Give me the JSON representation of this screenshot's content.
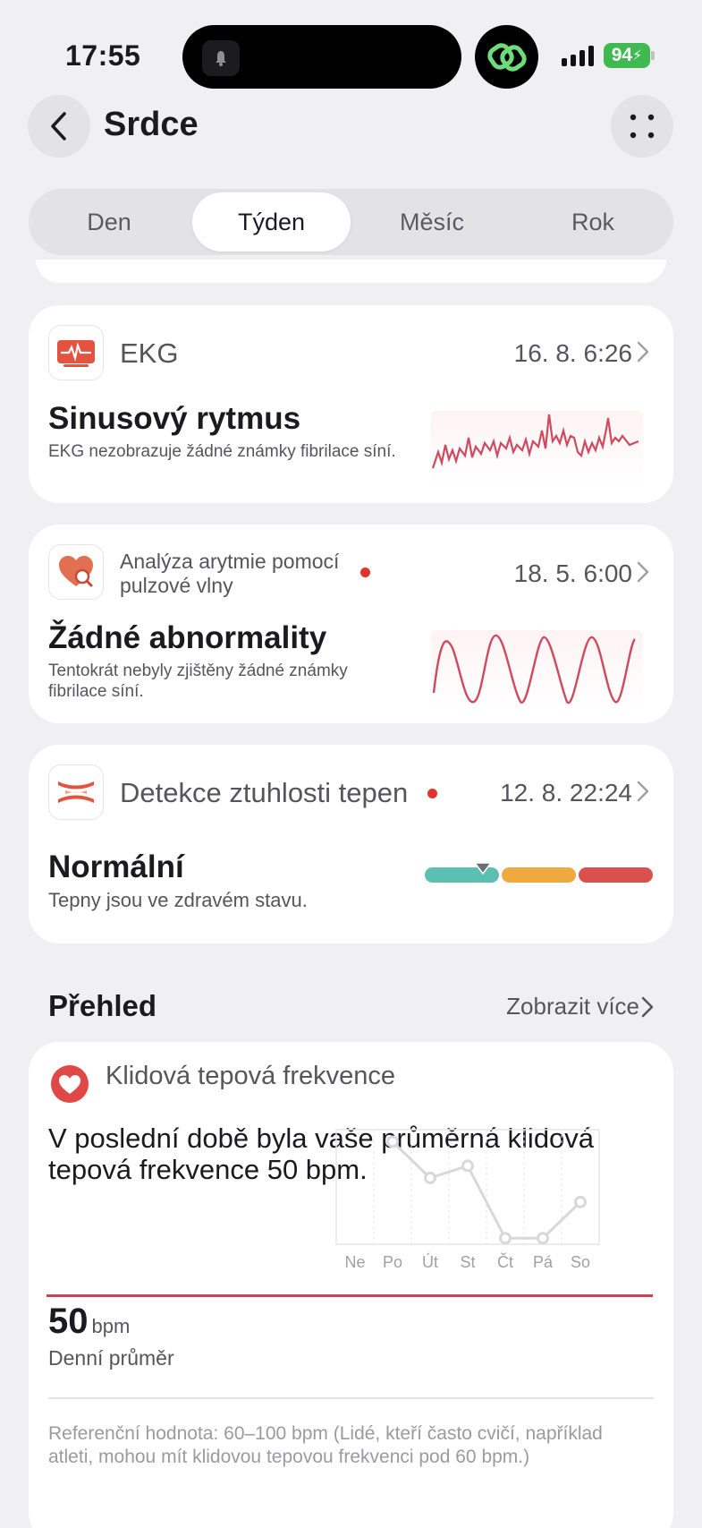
{
  "status_bar": {
    "time": "17:55",
    "battery": "94"
  },
  "header": {
    "title": "Srdce"
  },
  "tabs": [
    {
      "label": "Den",
      "active": false
    },
    {
      "label": "Týden",
      "active": true
    },
    {
      "label": "Měsíc",
      "active": false
    },
    {
      "label": "Rok",
      "active": false
    }
  ],
  "ekg": {
    "label": "EKG",
    "date": "16. 8. 6:26",
    "result": "Sinusový rytmus",
    "description": "EKG nezobrazuje žádné známky fibrilace síní."
  },
  "arrhythmia": {
    "label": "Analýza arytmie pomocí pulzové vlny",
    "date": "18. 5. 6:00",
    "result": "Žádné abnormality",
    "description": "Tentokrát nebyly zjištěny žádné známky fibrilace síní."
  },
  "arterial": {
    "label": "Detekce ztuhlosti tepen",
    "date": "12. 8. 22:24",
    "result": "Normální",
    "description": "Tepny jsou ve zdravém stavu.",
    "level": "normal",
    "scale_colors": [
      "#5bbfb1",
      "#f0a93f",
      "#d9504d"
    ]
  },
  "overview": {
    "title": "Přehled",
    "more": "Zobrazit více",
    "card_title": "Klidová tepová frekvence",
    "summary": "V poslední době byla vaše průměrná klidová tepová frekvence 50 bpm.",
    "avg_value": "50",
    "avg_unit": "bpm",
    "avg_caption": "Denní průměr",
    "reference": "Referenční hodnota: 60–100 bpm (Lidé, kteří často cvičí, například atleti, mohou mít klidovou tepovou frekvenci pod 60 bpm.)"
  },
  "chart_data": {
    "type": "line",
    "categories": [
      "Ne",
      "Po",
      "Út",
      "St",
      "Čt",
      "Pá",
      "So"
    ],
    "series": [
      {
        "values": [
          null,
          57,
          54,
          55,
          49,
          49,
          52
        ]
      }
    ],
    "reference_line": 50,
    "ylim": [
      48.5,
      58
    ],
    "grid": true,
    "colors": {
      "line": "#d8d8d8",
      "reference": "#c8435a"
    }
  }
}
